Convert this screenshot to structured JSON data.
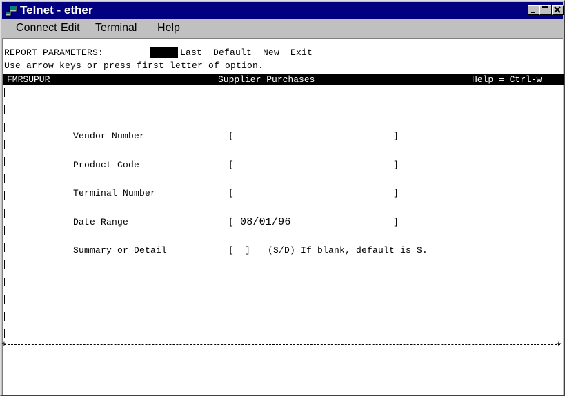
{
  "window": {
    "title": "Telnet - ether"
  },
  "icons": {
    "app": "telnet-computer-icon",
    "minimize": "minimize-icon",
    "maximize": "maximize-icon",
    "close": "close-icon"
  },
  "menu": {
    "connect": {
      "underline": "C",
      "rest": "onnect"
    },
    "edit": {
      "underline": "E",
      "rest": "dit"
    },
    "terminal": {
      "underline": "T",
      "rest": "erminal"
    },
    "help": {
      "underline": "H",
      "rest": "elp"
    }
  },
  "terminal": {
    "report_params_label": "REPORT PARAMETERS:",
    "options": "Last  Default  New  Exit",
    "instruction": "Use arrow keys or press first letter of option.",
    "header": {
      "program": "FMRSUPUR",
      "title": "Supplier Purchases",
      "help": "Help = Ctrl-w"
    },
    "fields": [
      {
        "label": "Vendor Number",
        "open": "[",
        "value": "",
        "close": "]"
      },
      {
        "label": "Product Code",
        "open": "[",
        "value": "",
        "close": "]"
      },
      {
        "label": "Terminal Number",
        "open": "[",
        "value": "",
        "close": "]"
      },
      {
        "label": "Date Range",
        "open": "[",
        "value": "08/01/96",
        "close": "]"
      }
    ],
    "summary": {
      "label": "Summary or Detail",
      "input": "[  ]",
      "hint": "(S/D) If blank, default is S."
    },
    "border_left_char": "+",
    "border_right_char": "+"
  },
  "colors": {
    "titlebar": "#000080",
    "chrome": "#c0c0c0",
    "terminal_bg": "#ffffff",
    "terminal_fg": "#000000"
  }
}
